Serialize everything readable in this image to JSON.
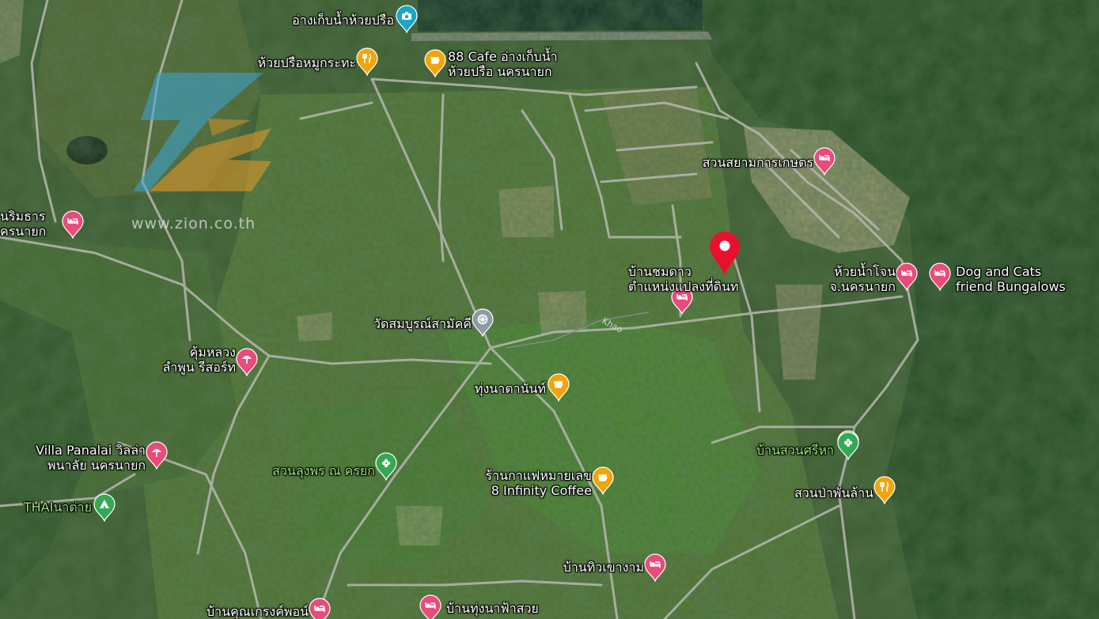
{
  "watermark": {
    "text": "www.zion.co.th"
  },
  "pins": [
    {
      "name": "reservoir-camera",
      "icon": "camera-icon",
      "color": "#1aa6c7",
      "label": "อ่างเก็บน้ำห้วยปรือ"
    },
    {
      "name": "restaurant-huai-prue",
      "icon": "fork-knife-icon",
      "color": "#f2a40c",
      "label": "ห้วยปรือหมูกระทะ"
    },
    {
      "name": "cafe-88",
      "icon": "coffee-cup-icon",
      "color": "#f2a40c",
      "label": "88 Cafe อ่างเก็บน้ำ\nห้วยปรือ นครนายก"
    },
    {
      "name": "hotel-suan-siam",
      "icon": "bed-icon",
      "color": "#e94b7a",
      "label": "สวนสยามการเกษตร"
    },
    {
      "name": "hotel-nimitara",
      "icon": "bed-icon",
      "color": "#e94b7a",
      "label": "นริมธาร\nครนายก"
    },
    {
      "name": "selected-location",
      "icon": "location-pin-icon",
      "color": "#e8112d",
      "label": ""
    },
    {
      "name": "hotel-baan-chom-dao",
      "icon": "bed-icon",
      "color": "#e94b7a",
      "label": "บ้านชมดาว\nตำแหน่งแปลงที่ดินท"
    },
    {
      "name": "hotel-huai-nam-chon",
      "icon": "bed-icon",
      "color": "#e94b7a",
      "label": "ห้วยน้ำโจน\nจ.นครนายก"
    },
    {
      "name": "hotel-dog-cats",
      "icon": "bed-icon",
      "color": "#e94b7a",
      "label": "Dog and Cats\nfriend Bungalows"
    },
    {
      "name": "park-right",
      "icon": "flower-icon",
      "color": "#34a853",
      "label": ""
    },
    {
      "name": "temple-wat",
      "icon": "dharma-wheel-icon",
      "color": "#8e9aa6",
      "label": "วัดสมบูรณ์สามัคคี"
    },
    {
      "name": "resort-khum-luang",
      "icon": "umbrella-icon",
      "color": "#e94b7a",
      "label": "คุ้มหลวง\nลำพูน รีสอร์ท"
    },
    {
      "name": "cafe-thung-na",
      "icon": "coffee-cup-icon",
      "color": "#f2a40c",
      "label": "ทุ่งนาตานันท์"
    },
    {
      "name": "villa-panalai",
      "icon": "umbrella-icon",
      "color": "#e94b7a",
      "label": "Villa Panalai วิลล่า\nพนาลัย นครนายก"
    },
    {
      "name": "park-suan-lung",
      "icon": "flower-icon",
      "color": "#34a853",
      "label": "สวนลุงพร ณ ครยก"
    },
    {
      "name": "park-baan-suan",
      "icon": "flower-icon",
      "color": "#34a853",
      "label": "บ้านสวนศรีหา"
    },
    {
      "name": "cafe-infinity",
      "icon": "coffee-cup-icon",
      "color": "#f2a40c",
      "label": "ร้านกาแฟหมายเลข\n8 Infinity Coffee"
    },
    {
      "name": "restaurant-suan-pa",
      "icon": "fork-knife-icon",
      "color": "#f2a40c",
      "label": "สวนป่าพันล้าน"
    },
    {
      "name": "camp-thai",
      "icon": "tent-icon",
      "color": "#34a853",
      "label": "THAIนาต่าย"
    },
    {
      "name": "hotel-baan-thiw",
      "icon": "bed-icon",
      "color": "#e94b7a",
      "label": "บ้านทิวเขางาม"
    },
    {
      "name": "hotel-baan-thung-na",
      "icon": "bed-icon",
      "color": "#e94b7a",
      "label": "บ้านทุ่งนาฟ้าสวย"
    },
    {
      "name": "hotel-bottom-left",
      "icon": "bed-icon",
      "color": "#e94b7a",
      "label": "บ้านคุณเกรงค์พอน์"
    }
  ],
  "road_label": "Khao",
  "colors": {
    "forest": "#244a22",
    "field": "#5a7a3a",
    "road": "#c9c9c9",
    "water": "#0e2a24"
  }
}
